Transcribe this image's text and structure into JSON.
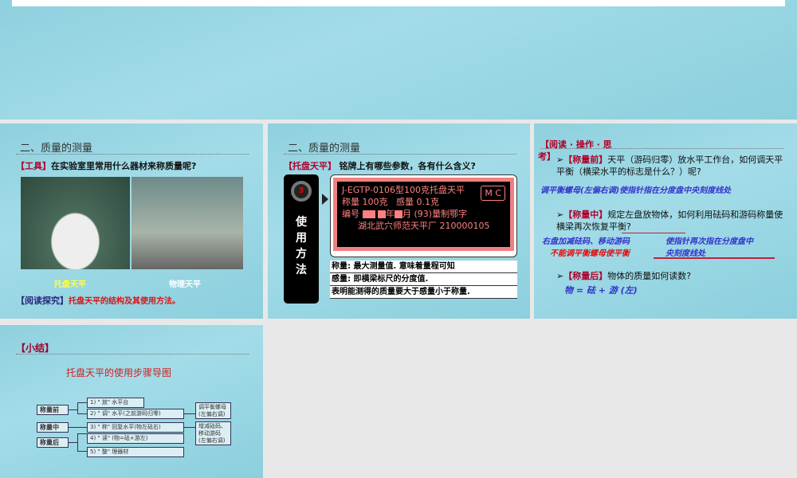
{
  "slide1": {
    "note": ""
  },
  "slide2": {
    "title": "二、质量的测量",
    "tool_label": "【工具】",
    "question": "在实验室里常用什么器材来称质量呢?",
    "caption_left": "托盘天平",
    "caption_right": "物理天平",
    "read_label": "【阅读探究】",
    "read_text": "托盘天平的结构及其使用方法。"
  },
  "slide3": {
    "title": "二、质量的测量",
    "label": "【托盘天平】",
    "question": "铭牌上有哪些参数，各有什么含义?",
    "step_number": "3",
    "step_chars": [
      "使",
      "用",
      "方",
      "法"
    ],
    "plate": {
      "line1": "J-EGTP-0106型100克托盘天平",
      "mc": "M C",
      "line2a": "称量 100克",
      "line2b": "感量  0.1克",
      "line3a": "编号",
      "line3b": "年",
      "line3c": "月",
      "line3d": "(93)量制鄂字",
      "line4": "湖北武穴师范天平厂  210000105"
    },
    "notes": [
      "称量: 最大测量值. 意味着量程可知",
      "感量: 即横梁标尺的分度值.",
      "表明能测得的质量要大于感量小于称量."
    ]
  },
  "slide4": {
    "header_a": "【阅读 · 操作 · 思",
    "header_b": "考】",
    "q1_label": "【称量前】",
    "q1_text": "天平（游码归零）放水平工作台，如何调天平平衡（横梁水平的标志是什么？）呢?",
    "a1": "调平衡螺母(左偏右调)使指针指在分度盘中央刻度线处",
    "q2_label": "【称量中】",
    "q2_text": "规定左盘放物体，如何利用砝码和游码称量使横梁再次恢复平衡?",
    "a2a": "右盘加减砝码、移动游码",
    "a2b": "使指针再次指在分度盘中",
    "a2c": "不能调平衡螺母使平衡",
    "a2d": "央刻度线处",
    "q3_label": "【称量后】",
    "q3_text": "物体的质量如何读数?",
    "a3": "物 = 砝 + 游 (左)"
  },
  "slide5": {
    "title": "【小结】",
    "subtitle": "托盘天平的使用步骤导图",
    "phases": [
      "称量前",
      "称量中",
      "称量后"
    ],
    "steps": [
      "1) \" 放\" 水平台",
      "2) \" 调\" 水平(之前游码归零)",
      "3) \" 称\" 回复水平(物左砝右)",
      "4) \" 读\" (物=砝+游左)",
      "5) \" 整\" 理器材"
    ],
    "side_notes": [
      "调平衡螺母\n(左偏右调)",
      "增减砝码、\n移动游码\n(左偏右调)"
    ]
  }
}
